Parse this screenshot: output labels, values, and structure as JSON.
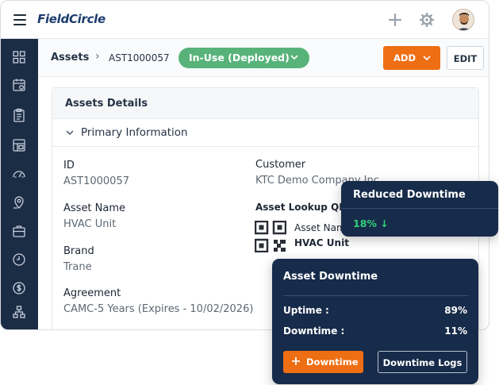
{
  "header": {
    "logo_text": "FieldCircle",
    "icons": [
      "menu-icon",
      "plus-icon",
      "gear-icon",
      "avatar"
    ]
  },
  "sidebar": {
    "icons": [
      "dashboard-icon",
      "calendar-icon",
      "clipboard-icon",
      "inventory-icon",
      "gauge-icon",
      "location-icon",
      "briefcase-icon",
      "clock-icon",
      "dollar-icon",
      "hierarchy-icon"
    ]
  },
  "breadcrumb": {
    "section": "Assets",
    "separator": "›",
    "asset_id": "AST1000057"
  },
  "status": {
    "label": "In-Use (Deployed)",
    "color": "#58b37a"
  },
  "actions": {
    "add_label": "ADD",
    "edit_label": "EDIT",
    "accent": "#ee6e13"
  },
  "card": {
    "title": "Assets Details",
    "section_title": "Primary Information",
    "fields": {
      "id_label": "ID",
      "id_value": "AST1000057",
      "name_label": "Asset Name",
      "name_value": "HVAC Unit",
      "brand_label": "Brand",
      "brand_value": "Trane",
      "agreement_label": "Agreement",
      "agreement_value": "CAMC-5 Years (Expires - 10/02/2026)",
      "customer_label": "Customer",
      "customer_value": "KTC Demo Company Inc",
      "qr_label": "Asset Lookup QR Code",
      "qr_name_label": "Asset Name",
      "qr_name_value": "HVAC Unit"
    }
  },
  "reduced_downtime": {
    "title": "Reduced Downtime",
    "value": "18%",
    "arrow": "↓",
    "value_color": "#33d17a"
  },
  "asset_downtime": {
    "title": "Asset Downtime",
    "uptime_label": "Uptime :",
    "uptime_value": "89%",
    "downtime_label": "Downtime :",
    "downtime_value": "11%",
    "downtime_button": "Downtime",
    "logs_button": "Downtime Logs"
  }
}
